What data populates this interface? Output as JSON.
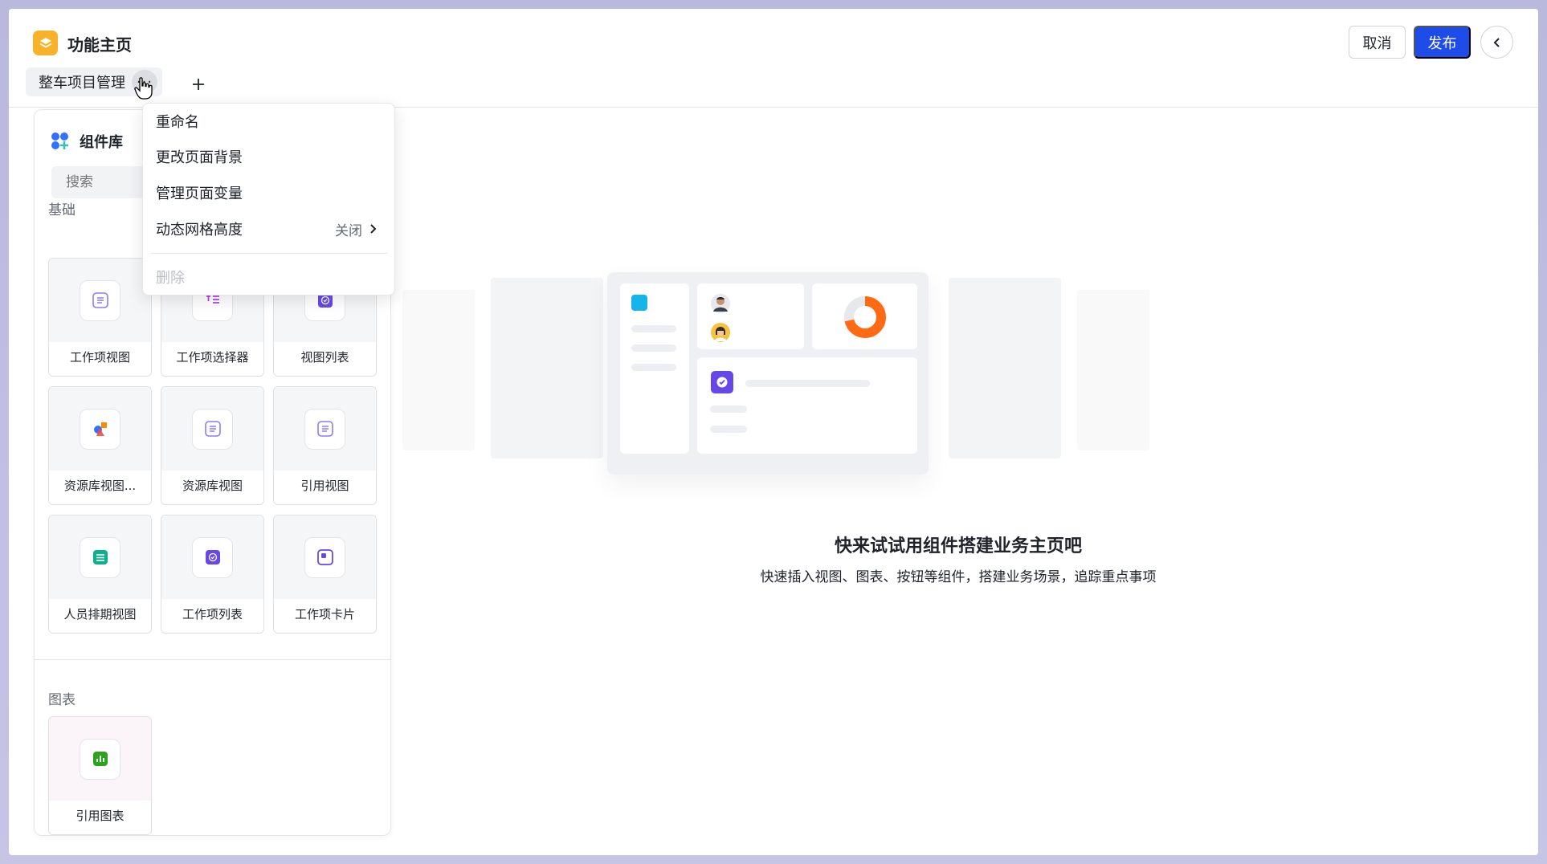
{
  "header": {
    "app_title": "功能主页",
    "active_tab": "整车项目管理",
    "cancel_label": "取消",
    "publish_label": "发布"
  },
  "dropdown_menu": {
    "items": [
      {
        "label": "重命名"
      },
      {
        "label": "更改页面背景"
      },
      {
        "label": "管理页面变量"
      },
      {
        "label": "动态网格高度",
        "value": "关闭"
      },
      {
        "label": "删除",
        "disabled": true
      }
    ]
  },
  "component_library": {
    "title": "组件库",
    "search_placeholder": "搜索",
    "sections": [
      {
        "label": "基础",
        "items": [
          {
            "label": "工作项视图",
            "icon": "list-icon"
          },
          {
            "label": "工作项选择器",
            "icon": "selector-icon"
          },
          {
            "label": "视图列表",
            "icon": "check-square-icon"
          },
          {
            "label": "资源库视图...",
            "icon": "shapes-icon"
          },
          {
            "label": "资源库视图",
            "icon": "list-icon"
          },
          {
            "label": "引用视图",
            "icon": "list-icon"
          },
          {
            "label": "人员排期视图",
            "icon": "calendar-icon"
          },
          {
            "label": "工作项列表",
            "icon": "check-square-icon"
          },
          {
            "label": "工作项卡片",
            "icon": "card-icon"
          }
        ]
      },
      {
        "label": "图表",
        "items": [
          {
            "label": "引用图表",
            "icon": "chart-icon"
          }
        ]
      }
    ]
  },
  "empty_state": {
    "title": "快来试试用组件搭建业务主页吧",
    "subtitle": "快速插入视图、图表、按钮等组件，搭建业务场景，追踪重点事项"
  },
  "colors": {
    "publish_button": "#1d4ce8",
    "app_logo": "#f7b22a",
    "donut": "#ff6a13"
  }
}
